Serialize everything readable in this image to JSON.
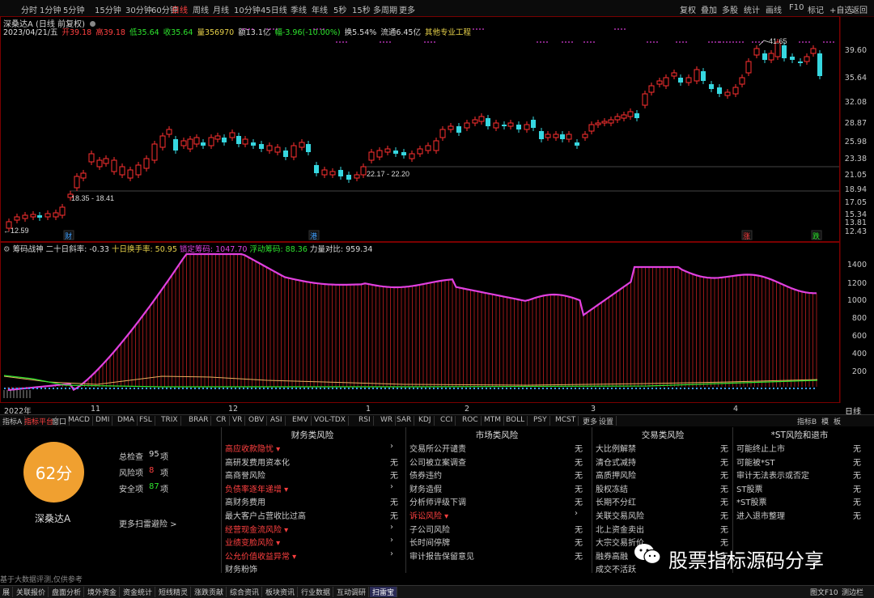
{
  "periods": [
    "分时",
    "1分钟",
    "5分钟",
    "15分钟",
    "30分钟",
    "60分钟",
    "日线",
    "周线",
    "月线",
    "10分钟",
    "45日线",
    "季线",
    "年线",
    "5秒",
    "15秒",
    "多周期",
    "更多"
  ],
  "active_period": "日线",
  "toolbar": [
    "复权",
    "叠加",
    "多股",
    "统计",
    "画线",
    "F10",
    "标记",
    "+自选",
    "返回"
  ],
  "stock": {
    "name": "深桑达A",
    "mode": "(日线 前复权)",
    "date": "2023/04/21/五"
  },
  "quote": {
    "open": "开39.18",
    "high": "高39.18",
    "low": "低35.64",
    "close": "收35.64",
    "volume": "量356970",
    "amount": "额13.1亿",
    "change": "幅-3.96(-10.00%)",
    "turnover": "换5.54%",
    "float_cap": "流通6.45亿",
    "industry": "其他专业工程"
  },
  "price_axis": [
    "39.60",
    "35.64",
    "32.08",
    "28.87",
    "25.98",
    "23.38",
    "21.05",
    "18.94",
    "17.05",
    "15.34",
    "13.81",
    "12.43"
  ],
  "price_labels": {
    "low_left": "12.59",
    "range_a": "18.35 - 18.41",
    "range_b": "22.17 - 22.20",
    "peak": "41.65"
  },
  "event_markers": {
    "cai": "财",
    "gang": "港",
    "zhang": "涨",
    "die": "跌"
  },
  "indicator": {
    "name": "筹码战神",
    "ma20": "二十日斜率: -0.33",
    "turn10": "十日换手率: 50.95",
    "locked": "锁定筹码: 1047.70",
    "floating": "浮动筹码: 88.36",
    "ratio": "力量对比: 959.34"
  },
  "indicator_axis": [
    "1400",
    "1200",
    "1000",
    "800",
    "600",
    "400",
    "200"
  ],
  "x_axis": [
    "2022年",
    "11",
    "12",
    "1",
    "2",
    "3",
    "4"
  ],
  "timeframe_label": "日线",
  "indicator_tabs": [
    "指标A",
    "指标平台",
    "窗口",
    "MACD",
    "DMI",
    "DMA",
    "FSL",
    "TRIX",
    "BRAR",
    "CR",
    "VR",
    "OBV",
    "ASI",
    "EMV",
    "VOL-TDX",
    "RSI",
    "WR",
    "SAR",
    "KDJ",
    "CCI",
    "ROC",
    "MTM",
    "BOLL",
    "PSY",
    "MCST",
    "更多",
    "设置"
  ],
  "indicator_tabs_right": [
    "指标B",
    "模",
    "板"
  ],
  "score": {
    "value": "62分",
    "name": "深桑达A",
    "more": "更多扫雷避险 >"
  },
  "stats": [
    {
      "label": "总检查",
      "value": "95",
      "unit": "项"
    },
    {
      "label": "风险项",
      "value": "8",
      "unit": "项"
    },
    {
      "label": "安全项",
      "value": "87",
      "unit": "项"
    }
  ],
  "risk_columns": [
    {
      "title": "财务类风险",
      "items": [
        {
          "label": "高应收款隐忧",
          "status": "›",
          "risk": true
        },
        {
          "label": "高研发费用资本化",
          "status": "无",
          "risk": false
        },
        {
          "label": "高商誉风险",
          "status": "无",
          "risk": false
        },
        {
          "label": "负债率逐年递增",
          "status": "›",
          "risk": true
        },
        {
          "label": "高财务费用",
          "status": "无",
          "risk": false
        },
        {
          "label": "最大客户占营收比过高",
          "status": "无",
          "risk": false
        },
        {
          "label": "经营现金流风险",
          "status": "›",
          "risk": true
        },
        {
          "label": "业绩变脸风险",
          "status": "›",
          "risk": true
        },
        {
          "label": "公允价值收益异常",
          "status": "›",
          "risk": true
        },
        {
          "label": "财务粉饰",
          "status": "",
          "risk": false
        }
      ]
    },
    {
      "title": "市场类风险",
      "items": [
        {
          "label": "交易所公开谴责",
          "status": "无",
          "risk": false
        },
        {
          "label": "公司被立案调查",
          "status": "无",
          "risk": false
        },
        {
          "label": "债券违约",
          "status": "无",
          "risk": false
        },
        {
          "label": "财务造假",
          "status": "无",
          "risk": false
        },
        {
          "label": "分析师评级下调",
          "status": "无",
          "risk": false
        },
        {
          "label": "诉讼风险",
          "status": "›",
          "risk": true
        },
        {
          "label": "子公司风险",
          "status": "无",
          "risk": false
        },
        {
          "label": "长时间停牌",
          "status": "无",
          "risk": false
        },
        {
          "label": "审计报告保留意见",
          "status": "无",
          "risk": false
        }
      ]
    },
    {
      "title": "交易类风险",
      "items": [
        {
          "label": "大比例解禁",
          "status": "无",
          "risk": false
        },
        {
          "label": "清仓式减持",
          "status": "无",
          "risk": false
        },
        {
          "label": "高质押风险",
          "status": "无",
          "risk": false
        },
        {
          "label": "股权冻结",
          "status": "无",
          "risk": false
        },
        {
          "label": "长期不分红",
          "status": "无",
          "risk": false
        },
        {
          "label": "关联交易风险",
          "status": "无",
          "risk": false
        },
        {
          "label": "北上资金卖出",
          "status": "无",
          "risk": false
        },
        {
          "label": "大宗交易折价",
          "status": "无",
          "risk": false
        },
        {
          "label": "融券高融",
          "status": "无",
          "risk": false
        },
        {
          "label": "成交不活跃",
          "status": "",
          "risk": false
        }
      ]
    },
    {
      "title": "*ST风险和退市",
      "items": [
        {
          "label": "可能终止上市",
          "status": "无",
          "risk": false
        },
        {
          "label": "可能被*ST",
          "status": "无",
          "risk": false
        },
        {
          "label": "审计无法表示或否定",
          "status": "无",
          "risk": false
        },
        {
          "label": "ST股票",
          "status": "无",
          "risk": false
        },
        {
          "label": "*ST股票",
          "status": "无",
          "risk": false
        },
        {
          "label": "进入退市整理",
          "status": "无",
          "risk": false
        }
      ]
    }
  ],
  "disclaimer": "基于大数据评测,仅供参考",
  "bottom_tabs": [
    "展",
    "关联报价",
    "盘面分析",
    "境外资金",
    "资金统计",
    "短线精灵",
    "涨跌贡献",
    "综合资讯",
    "板块资讯",
    "行业数据",
    "互动调研",
    "扫雷宝"
  ],
  "active_bottom_tab": "扫雷宝",
  "bottom_right": [
    "图文F10",
    "测边栏"
  ],
  "watermark": "股票指标源码分享",
  "colors": {
    "up": "#ff3030",
    "down": "#36d7e0",
    "magenta": "#e040e0",
    "accent": "#f0a030",
    "border": "#7a0000"
  }
}
